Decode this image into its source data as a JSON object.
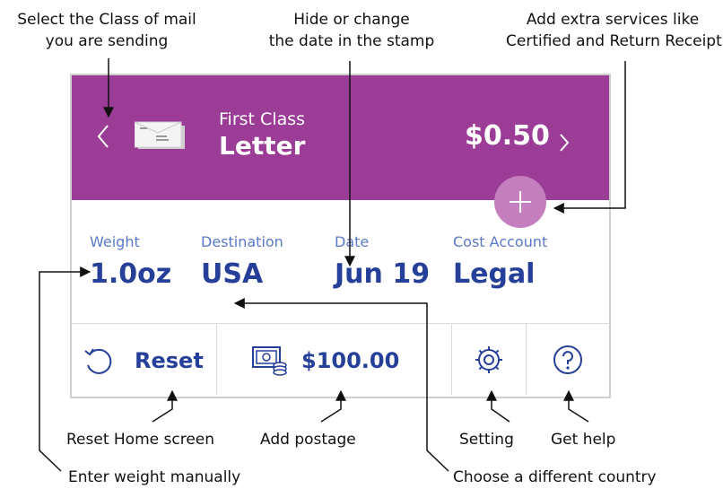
{
  "callouts": {
    "select_class": [
      "Select the Class of mail",
      "you are sending"
    ],
    "date_stamp": [
      "Hide or change",
      "the date in the stamp"
    ],
    "extra_services": [
      "Add extra services like",
      "Certified and Return Receipt"
    ],
    "reset_home": "Reset Home screen",
    "add_postage": "Add postage",
    "setting": "Setting",
    "get_help": "Get help",
    "enter_weight": "Enter weight manually",
    "choose_country": "Choose a different country"
  },
  "header": {
    "class_sub": "First Class",
    "class_main": "Letter",
    "price": "$0.50"
  },
  "fields": {
    "weight_label": "Weight",
    "weight_value": "1.0oz",
    "destination_label": "Destination",
    "destination_value": "USA",
    "date_label": "Date",
    "date_value": "Jun 19",
    "cost_label": "Cost Account",
    "cost_value": "Legal"
  },
  "bottom": {
    "reset_label": "Reset",
    "postage_amount": "$100.00"
  },
  "icons": {
    "prev": "chevron-left-icon",
    "next": "chevron-right-icon",
    "envelope": "envelope-icon",
    "plus": "plus-icon",
    "reset": "reset-icon",
    "postage": "postage-money-icon",
    "settings": "gear-icon",
    "help": "help-icon"
  },
  "colors": {
    "header_bg": "#9b3c96",
    "plus_bg": "#c67fbe",
    "value_text": "#26409a",
    "label_text": "#5a79c7"
  }
}
